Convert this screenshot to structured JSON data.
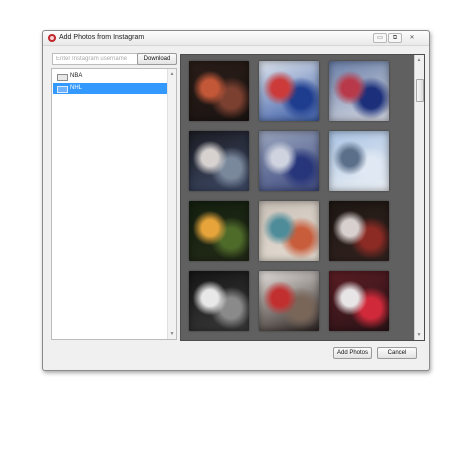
{
  "window": {
    "title": "Add Photos from Instagram",
    "controls": {
      "minimize": "▭",
      "maximize": "⧉",
      "close": "✕"
    }
  },
  "search": {
    "placeholder": "Enter Instagram username",
    "value": "",
    "download_label": "Download"
  },
  "accounts": {
    "items": [
      {
        "label": "NBA",
        "selected": false
      },
      {
        "label": "NHL",
        "selected": true
      }
    ]
  },
  "photos": {
    "count": 12,
    "items": [
      {
        "name": "photo-1",
        "colors": [
          "#2b1d18",
          "#7b4030",
          "#c25838",
          "#1a1412"
        ]
      },
      {
        "name": "photo-2",
        "colors": [
          "#dfe6ee",
          "#1e3d8f",
          "#cc3a3a",
          "#3d5ea8"
        ]
      },
      {
        "name": "photo-3",
        "colors": [
          "#6a7fa8",
          "#1b2f7a",
          "#b83a4a",
          "#d6d9e3"
        ]
      },
      {
        "name": "photo-4",
        "colors": [
          "#1c1d24",
          "#7a889c",
          "#d7d2d0",
          "#3e4a66"
        ]
      },
      {
        "name": "photo-5",
        "colors": [
          "#9aa6bf",
          "#27357a",
          "#cfd3df",
          "#3e497e"
        ]
      },
      {
        "name": "photo-6",
        "colors": [
          "#a9c3e3",
          "#dfe8f3",
          "#5c6f8a",
          "#eef2f6"
        ]
      },
      {
        "name": "photo-7",
        "colors": [
          "#14200f",
          "#4f6b2a",
          "#e6a43a",
          "#232a17"
        ]
      },
      {
        "name": "photo-8",
        "colors": [
          "#c9c1b8",
          "#c85d3c",
          "#4e8c9a",
          "#e6ded3"
        ]
      },
      {
        "name": "photo-9",
        "colors": [
          "#1e1713",
          "#8c2a24",
          "#d8d0cf",
          "#33231f"
        ]
      },
      {
        "name": "photo-10",
        "colors": [
          "#161616",
          "#8a8a8a",
          "#e8e8e8",
          "#3a3a3a"
        ]
      },
      {
        "name": "photo-11",
        "colors": [
          "#e7e2de",
          "#7a6659",
          "#c22f2f",
          "#2d2522"
        ]
      },
      {
        "name": "photo-12",
        "colors": [
          "#5a1d24",
          "#d02a3a",
          "#e8e5e7",
          "#2c1418"
        ]
      }
    ]
  },
  "footer": {
    "add_label": "Add Photos",
    "cancel_label": "Cancel"
  }
}
